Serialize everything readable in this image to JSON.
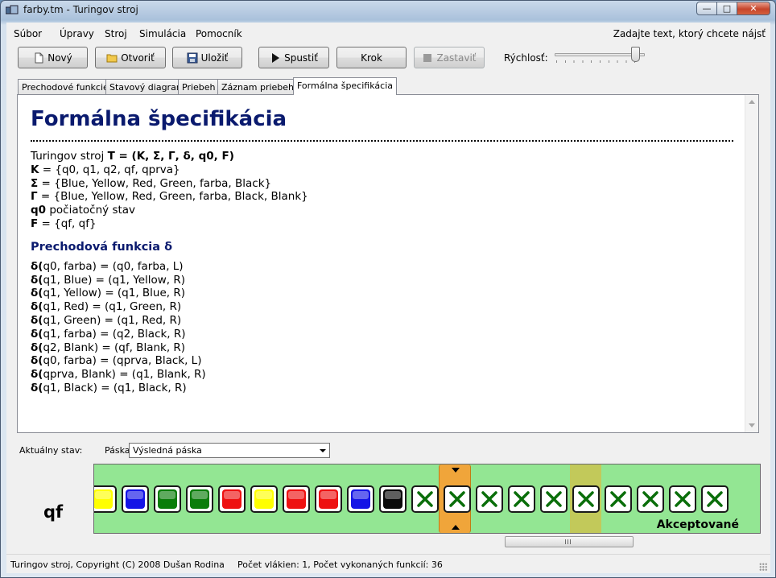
{
  "window": {
    "title": "farby.tm - Turingov stroj"
  },
  "menu": {
    "items": [
      "Súbor",
      "Úpravy",
      "Stroj",
      "Simulácia",
      "Pomocník"
    ],
    "search_hint": "Zadajte text, ktorý chcete nájsť"
  },
  "toolbar": {
    "new_label": "Nový",
    "open_label": "Otvoriť",
    "save_label": "Uložiť",
    "run_label": "Spustiť",
    "step_label": "Krok",
    "stop_label": "Zastaviť",
    "speed_label": "Rýchlosť:",
    "speed_value": 0.92
  },
  "tabs": [
    "Prechodové funkcie",
    "Stavový diagram",
    "Priebeh",
    "Záznam priebehu",
    "Formálna špecifikácia"
  ],
  "spec": {
    "title": "Formálna špecifikácia",
    "machine_prefix": "Turingov stroj ",
    "machine_T": "T",
    "machine_def": " = (K, Σ, Γ, δ, q0, F)",
    "K_sym": "K",
    "K_val": " = {q0, q1, q2, qf, qprva}",
    "Sigma_sym": "Σ",
    "Sigma_val": " = {Blue, Yellow, Red, Green, farba, Black}",
    "Gamma_sym": "Γ",
    "Gamma_val": " = {Blue, Yellow, Red, Green, farba, Black, Blank}",
    "q0_sym": "q0",
    "q0_val": " počiatočný stav",
    "F_sym": "F",
    "F_val": " = {qf, qf}",
    "transitions_title": "Prechodová funkcia δ",
    "delta_sym": "δ(",
    "transitions": [
      "q0, farba) = (q0, farba, L)",
      "q1, Blue) = (q1, Yellow, R)",
      "q1, Yellow) = (q1, Blue, R)",
      "q1, Red) = (q1, Green, R)",
      "q1, Green) = (q1, Red, R)",
      "q1, farba) = (q2, Black, R)",
      "q2, Blank) = (qf, Blank, R)",
      "q0, farba) = (qprva, Black, L)",
      "qprva, Blank) = (q1, Blank, R)",
      "q1, Black) = (q1, Black, R)"
    ]
  },
  "sim": {
    "state_label": "Aktuálny stav:",
    "tape_label": "Páska:",
    "tape_select": "Výsledná páska",
    "current_state": "qf",
    "accept_text": "Akceptované",
    "tape_cells": [
      "yellow",
      "blue",
      "green",
      "green",
      "red",
      "yellow",
      "red",
      "red",
      "blue",
      "black",
      "x",
      "x",
      "x",
      "x",
      "x",
      "x",
      "x",
      "x",
      "x",
      "x"
    ],
    "head_index": 11,
    "highlight_index": 15,
    "colors": {
      "yellow": "#ffff00",
      "blue": "#1414e6",
      "green": "#0a7d0a",
      "red": "#ee1111",
      "black": "#0a0a0a",
      "x": "#0a6e0a",
      "tape_bg": "#93e693",
      "head": "#f0a53a"
    }
  },
  "status": {
    "copyright": "Turingov stroj, Copyright (C) 2008 Dušan Rodina",
    "stats": "Počet vlákien: 1, Počet vykonaných funkcií: 36"
  }
}
